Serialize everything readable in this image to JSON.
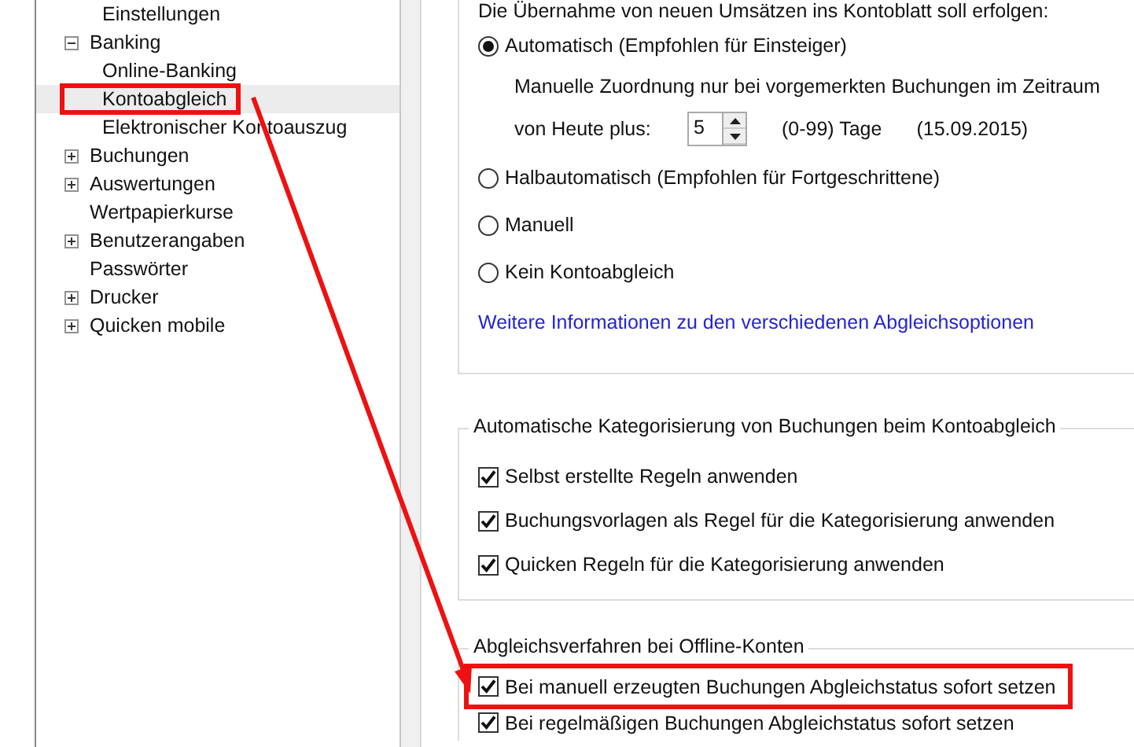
{
  "tree": {
    "scrolled_children": [
      {
        "label": "Einstellungen"
      }
    ],
    "items": [
      {
        "label": "Banking",
        "kind": "folder",
        "expanded": true,
        "selected": false,
        "children": [
          {
            "label": "Online-Banking",
            "selected": false,
            "annotated": false
          },
          {
            "label": "Kontoabgleich",
            "selected": true,
            "annotated": true
          },
          {
            "label": "Elektronischer Kontoauszug",
            "selected": false,
            "annotated": false
          }
        ]
      },
      {
        "label": "Buchungen",
        "kind": "folder",
        "expanded": false,
        "selected": false
      },
      {
        "label": "Auswertungen",
        "kind": "folder",
        "expanded": false,
        "selected": false
      },
      {
        "label": "Wertpapierkurse",
        "kind": "page",
        "selected": false,
        "annotated": false
      },
      {
        "label": "Benutzerangaben",
        "kind": "folder",
        "expanded": false,
        "selected": false
      },
      {
        "label": "Passwörter",
        "kind": "page",
        "selected": false,
        "annotated": false
      },
      {
        "label": "Drucker",
        "kind": "folder",
        "expanded": false,
        "selected": false
      },
      {
        "label": "Quicken mobile",
        "kind": "folder",
        "expanded": false,
        "selected": false
      }
    ]
  },
  "transfer_group": {
    "intro": "Die Übernahme von neuen Umsätzen ins Kontoblatt soll erfolgen:",
    "options": [
      {
        "label": "Automatisch (Empfohlen für Einsteiger)",
        "selected": true
      },
      {
        "label": "Halbautomatisch (Empfohlen für Fortgeschrittene)",
        "selected": false
      },
      {
        "label": "Manuell",
        "selected": false
      },
      {
        "label": "Kein Kontoabgleich",
        "selected": false
      }
    ],
    "auto_details": {
      "text": "Manuelle Zuordnung nur bei vorgemerkten Buchungen im Zeitraum",
      "spinner_label": "von Heute plus:",
      "spinner_value": "5",
      "range": "(0-99) Tage",
      "date": "(15.09.2015)"
    },
    "link": "Weitere Informationen zu den verschiedenen Abgleichsoptionen"
  },
  "categorization_group": {
    "title": "Automatische Kategorisierung von Buchungen beim Kontoabgleich",
    "options": [
      {
        "label": "Selbst erstellte Regeln anwenden",
        "checked": true,
        "annotated": false
      },
      {
        "label": "Buchungsvorlagen als Regel für die Kategorisierung anwenden",
        "checked": true,
        "annotated": false
      },
      {
        "label": "Quicken Regeln für die Kategorisierung anwenden",
        "checked": true,
        "annotated": false
      }
    ]
  },
  "offline_group": {
    "title": "Abgleichsverfahren bei Offline-Konten",
    "options": [
      {
        "label": "Bei manuell erzeugten Buchungen Abgleichstatus sofort setzen",
        "checked": true,
        "annotated": true
      },
      {
        "label": "Bei regelmäßigen Buchungen Abgleichstatus sofort setzen",
        "checked": true,
        "annotated": false
      }
    ]
  }
}
